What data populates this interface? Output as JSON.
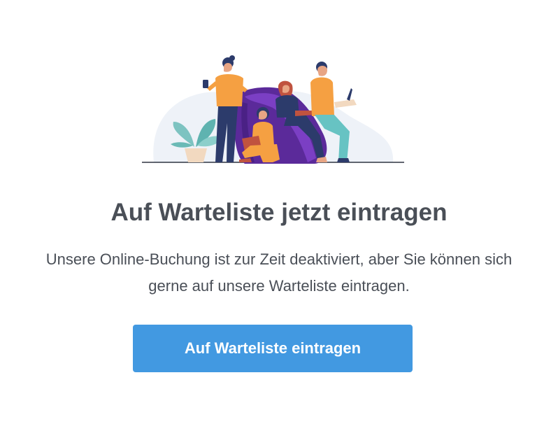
{
  "illustration": {
    "icon": "people-relaxing-illustration"
  },
  "heading": "Auf Warteliste jetzt eintragen",
  "description_line1": "Unsere Online-Buchung ist zur Zeit deaktiviert, aber Sie können sich",
  "description_line2": "gerne auf unsere Warteliste eintragen.",
  "button_label": "Auf Warteliste eintragen",
  "colors": {
    "button_bg": "#4299e1",
    "text": "#4a4f57"
  }
}
